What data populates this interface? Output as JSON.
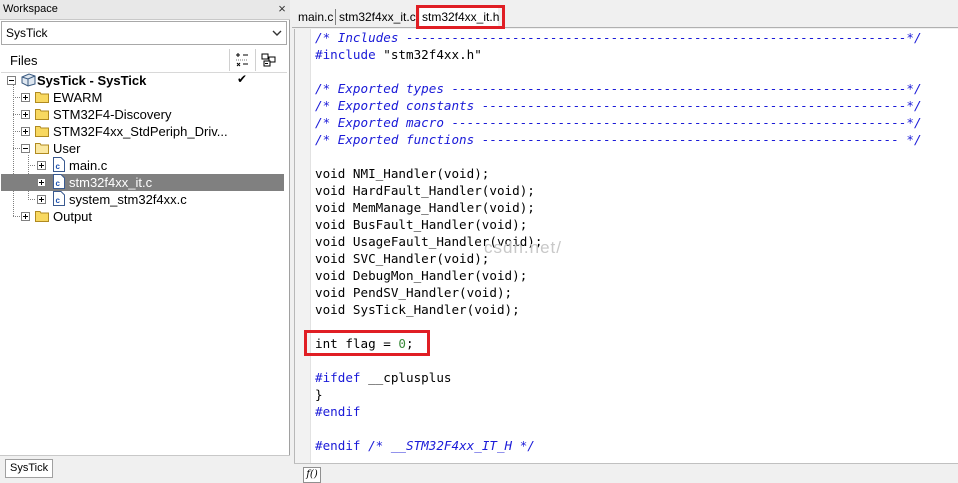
{
  "workspace": {
    "title": "Workspace",
    "close_glyph": "×",
    "config_selected": "SysTick",
    "files_header": "Files",
    "bottom_tab": "SysTick",
    "tree": {
      "project": "SysTick - SysTick",
      "project_check": "✔",
      "groups": {
        "ewarm": "EWARM",
        "discovery": "STM32F4-Discovery",
        "stdperiph": "STM32F4xx_StdPeriph_Driv...",
        "user": "User",
        "output": "Output"
      },
      "user_files": {
        "main": "main.c",
        "it": "stm32f4xx_it.c",
        "system": "system_stm32f4xx.c"
      }
    }
  },
  "editor": {
    "tabs": [
      "main.c",
      "stm32f4xx_it.c",
      "stm32f4xx_it.h"
    ],
    "active_tab": "stm32f4xx_it.h",
    "function_button": "f()",
    "watermark": "csdn.net/",
    "code": {
      "l1": "/* Includes ------------------------------------------------------------------*/",
      "l2a": "#include",
      "l2b": " \"stm32f4xx.h\"",
      "l3": "/* Exported types ------------------------------------------------------------*/",
      "l4": "/* Exported constants --------------------------------------------------------*/",
      "l5": "/* Exported macro ------------------------------------------------------------*/",
      "l6": "/* Exported functions ------------------------------------------------------- */",
      "f1": "void NMI_Handler(void);",
      "f2": "void HardFault_Handler(void);",
      "f3": "void MemManage_Handler(void);",
      "f4": "void BusFault_Handler(void);",
      "f5": "void UsageFault_Handler(void);",
      "f6": "void SVC_Handler(void);",
      "f7": "void DebugMon_Handler(void);",
      "f8": "void PendSV_Handler(void);",
      "f9": "void SysTick_Handler(void);",
      "flag_a": "int flag = ",
      "flag_num": "0",
      "flag_b": ";",
      "ifdef_a": "#ifdef",
      "ifdef_b": " __cplusplus",
      "brace": "}",
      "endif1": "#endif",
      "endif2_a": "#endif",
      "endif2_b": " /* __STM32F4xx_IT_H */"
    }
  },
  "colors": {
    "highlight_box": "#e01e24",
    "comment": "#1a1ad8",
    "preprocessor": "#1a1ad8",
    "number": "#3a8a3a",
    "selection": "#808080"
  }
}
